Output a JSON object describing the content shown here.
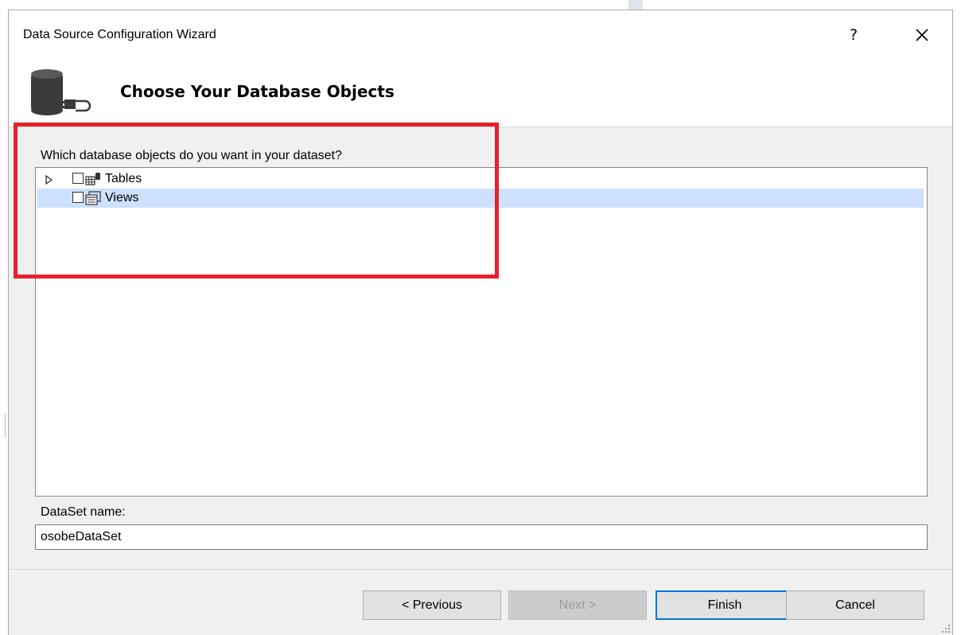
{
  "window": {
    "title": "Data Source Configuration Wizard",
    "help_label": "?",
    "close_icon": "close-icon"
  },
  "header": {
    "title": "Choose Your Database Objects",
    "icon": "database-icon"
  },
  "objects": {
    "prompt": "Which database objects do you want in your dataset?",
    "items": [
      {
        "label": "Tables",
        "checked": false,
        "expandable": true,
        "icon": "tables-icon"
      },
      {
        "label": "Views",
        "checked": false,
        "expandable": false,
        "icon": "views-icon",
        "selected": true
      }
    ]
  },
  "dataset": {
    "label": "DataSet name:",
    "value": "osobeDataSet"
  },
  "buttons": {
    "previous": "< Previous",
    "next": "Next >",
    "finish": "Finish",
    "cancel": "Cancel"
  },
  "colors": {
    "highlight": "#e8202b",
    "selection": "#cce0ff",
    "default_button_border": "#0078d7"
  }
}
